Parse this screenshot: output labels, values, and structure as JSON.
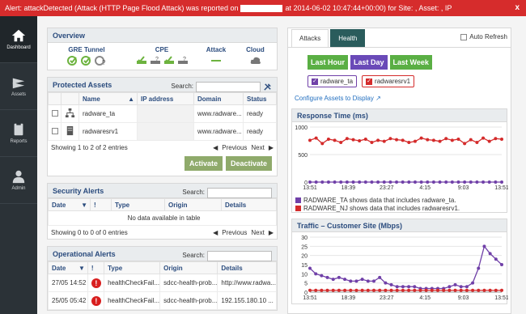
{
  "alert": {
    "prefix": "Alert: attackDetected (Attack (HTTP Page Flood Attack) was reported on",
    "suffix": "at 2014-06-02 10:47:44+00:00) for Site: , Asset: , IP",
    "close": "x"
  },
  "sidebar": [
    {
      "label": "Dashboard",
      "icon": "home-icon",
      "active": true
    },
    {
      "label": "Assets",
      "icon": "assets-icon",
      "active": false
    },
    {
      "label": "Reports",
      "icon": "reports-icon",
      "active": false
    },
    {
      "label": "Admin",
      "icon": "admin-icon",
      "active": false
    }
  ],
  "overview": {
    "title": "Overview",
    "columns": [
      "GRE Tunnel",
      "CPE",
      "Attack",
      "Cloud"
    ]
  },
  "protected_assets": {
    "title": "Protected Assets",
    "search_label": "Search:",
    "columns": [
      "Name",
      "IP address",
      "Domain",
      "Status"
    ],
    "rows": [
      {
        "name": "radware_ta",
        "ip": "",
        "domain": "www.radware...",
        "status": "ready"
      },
      {
        "name": "radwaresrv1",
        "ip": "",
        "domain": "www.radware...",
        "status": "ready"
      }
    ],
    "info": "Showing 1 to 2 of 2 entries",
    "prev": "Previous",
    "next": "Next",
    "activate": "Activate",
    "deactivate": "Deactivate"
  },
  "security_alerts": {
    "title": "Security Alerts",
    "search_label": "Search:",
    "columns": [
      "Date",
      "!",
      "Type",
      "Origin",
      "Details"
    ],
    "empty": "No data available in table",
    "info": "Showing 0 to 0 of 0 entries",
    "prev": "Previous",
    "next": "Next"
  },
  "operational_alerts": {
    "title": "Operational Alerts",
    "search_label": "Search:",
    "columns": [
      "Date",
      "!",
      "Type",
      "Origin",
      "Details"
    ],
    "rows": [
      {
        "date": "27/05 14:52",
        "type": "healthCheckFail...",
        "origin": "sdcc-health-prob...",
        "details": "http://www.radwa..."
      },
      {
        "date": "25/05 05:42",
        "type": "healthCheckFail...",
        "origin": "sdcc-health-prob...",
        "details": "192.155.180.10 ..."
      }
    ]
  },
  "right_panel": {
    "tabs": [
      "Attacks",
      "Health"
    ],
    "auto_refresh": "Auto Refresh",
    "ranges": [
      {
        "label": "Last Hour",
        "selected": false
      },
      {
        "label": "Last Day",
        "selected": true
      },
      {
        "label": "Last Week",
        "selected": false
      }
    ],
    "assets": [
      {
        "label": "radware_ta",
        "color": "#7040a8"
      },
      {
        "label": "radwaresrv1",
        "color": "#d42b2b"
      }
    ],
    "configure_link": "Configure Assets to Display"
  },
  "colors": {
    "ta": "#7040a8",
    "srv": "#d42b2b"
  },
  "chart_data": [
    {
      "type": "line",
      "title": "Response Time (ms)",
      "ylim": [
        0,
        1000
      ],
      "yticks": [
        0,
        500,
        1000
      ],
      "xticks": [
        "13:51",
        "18:39",
        "23:27",
        "4:15",
        "9:03",
        "13:51"
      ],
      "series": [
        {
          "name": "RADWARE_TA",
          "values": [
            0,
            0,
            0,
            0,
            0,
            0,
            0,
            0,
            0,
            0,
            0,
            0,
            0,
            0,
            0,
            0,
            0,
            0,
            0,
            0,
            0,
            0,
            0,
            0,
            0,
            0,
            0,
            0,
            0,
            0,
            0,
            0
          ]
        },
        {
          "name": "RADWARE_NJ",
          "values": [
            760,
            800,
            700,
            780,
            760,
            720,
            790,
            770,
            750,
            780,
            720,
            760,
            740,
            790,
            770,
            760,
            720,
            740,
            800,
            770,
            760,
            740,
            790,
            760,
            780,
            700,
            770,
            720,
            800,
            740,
            790,
            780
          ]
        }
      ],
      "legend": [
        "RADWARE_TA shows data that includes radware_ta.",
        "RADWARE_NJ shows data that includes radwaresrv1."
      ]
    },
    {
      "type": "line",
      "title": "Traffic – Customer Site (Mbps)",
      "ylim": [
        0,
        30
      ],
      "yticks": [
        0,
        5,
        10,
        15,
        20,
        25,
        30
      ],
      "xticks": [
        "13:51",
        "18:39",
        "23:27",
        "4:15",
        "9:03",
        "13:51"
      ],
      "series": [
        {
          "name": "RADWARE_TA",
          "values": [
            13,
            10,
            9,
            8,
            7,
            8,
            7,
            6,
            6,
            7,
            6,
            6,
            8,
            5,
            4,
            3,
            3,
            3,
            3,
            2,
            2,
            2,
            2,
            2,
            3,
            4,
            3,
            3,
            5,
            13,
            25,
            21,
            18,
            15
          ]
        },
        {
          "name": "RADWARE_NJ",
          "values": [
            1,
            1,
            1,
            1,
            1,
            1,
            1,
            1,
            1,
            1,
            1,
            1,
            1,
            1,
            1,
            1,
            1,
            1,
            1,
            1,
            1,
            1,
            1,
            1,
            1,
            1,
            1,
            1,
            1,
            1,
            1,
            1,
            1,
            1
          ]
        }
      ]
    }
  ]
}
